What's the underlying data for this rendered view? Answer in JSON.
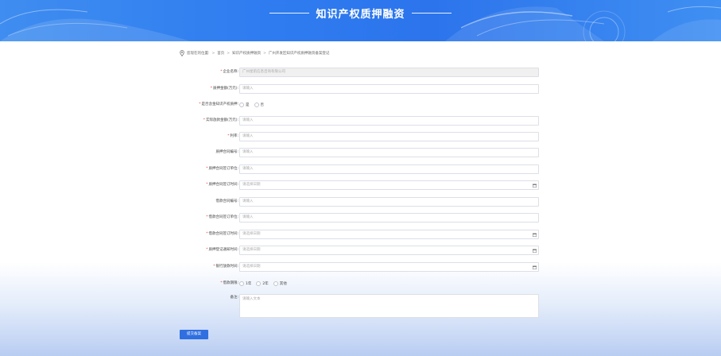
{
  "banner": {
    "title": "知识产权质押融资"
  },
  "breadcrumb": {
    "prefix": "您现在的位置:",
    "sep": ">",
    "items": [
      "首页",
      "知识产权质押融资",
      "广州开发区知识产权质押融资备案登记"
    ]
  },
  "form": {
    "company_name": {
      "label": "企业名称:",
      "value": "广州星航信息咨询有限公司"
    },
    "pledge_amount": {
      "label": "质押金额(万元):",
      "placeholder": "请输入"
    },
    "is_pledge": {
      "label": "是否含金知识产权质押:",
      "options": [
        "是",
        "否"
      ]
    },
    "actual_loan": {
      "label": "实际放款金额(万元):",
      "placeholder": "请输入"
    },
    "interest_rate": {
      "label": "利率:",
      "placeholder": "请输入"
    },
    "pledge_contract_no": {
      "label": "质押合同编号:",
      "placeholder": "请输入"
    },
    "pledge_signer": {
      "label": "质押合同签订单位:",
      "placeholder": "请输入"
    },
    "pledge_sign_time": {
      "label": "质押合同签订时间:",
      "placeholder": "请选择日期"
    },
    "loan_contract_no": {
      "label": "借款合同编号:",
      "placeholder": "请输入"
    },
    "loan_signer": {
      "label": "借款合同签订单位:",
      "placeholder": "请输入"
    },
    "loan_sign_time": {
      "label": "借款合同签订时间:",
      "placeholder": "请选择日期"
    },
    "pledge_reg_time": {
      "label": "质押登记通知时间:",
      "placeholder": "请选择日期"
    },
    "bank_loan_time": {
      "label": "银行放款时间:",
      "placeholder": "请选择日期"
    },
    "loan_term": {
      "label": "借款期限:",
      "options": [
        "1年",
        "2年",
        "其他"
      ]
    },
    "remark": {
      "label": "备注:",
      "placeholder": "请输入文本"
    },
    "submit_label": "提交备案"
  },
  "colors": {
    "primary": "#2f6fe0",
    "required": "#e53935",
    "banner": "#2f7df0"
  }
}
